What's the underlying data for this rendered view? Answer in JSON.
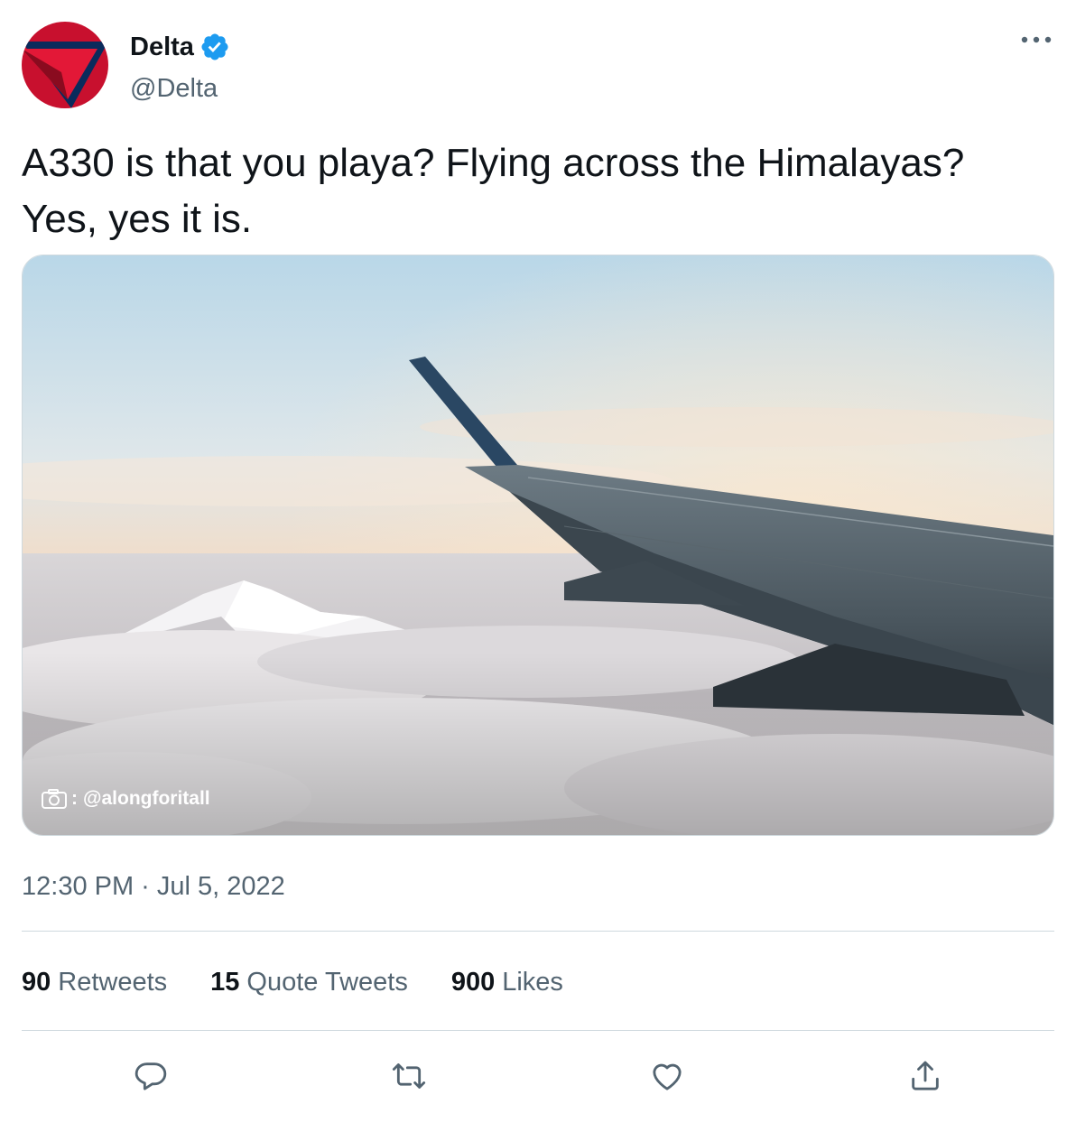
{
  "author": {
    "display_name": "Delta",
    "handle": "@Delta",
    "verified": true,
    "brand_colors": {
      "red": "#c8102e",
      "navy": "#0a2b5c"
    }
  },
  "tweet": {
    "text_lines": [
      "A330 is that you playa? Flying across the Himalayas?",
      "Yes, yes it is."
    ],
    "media": {
      "credit_separator": ":",
      "credit_handle": "@alongforitall",
      "credit_icon": "camera-icon"
    },
    "timestamp": "12:30 PM · Jul 5, 2022"
  },
  "stats": [
    {
      "count": "90",
      "label": "Retweets"
    },
    {
      "count": "15",
      "label": "Quote Tweets"
    },
    {
      "count": "900",
      "label": "Likes"
    }
  ],
  "actions": [
    {
      "icon": "reply-icon"
    },
    {
      "icon": "retweet-icon"
    },
    {
      "icon": "like-icon"
    },
    {
      "icon": "share-icon"
    }
  ],
  "colors": {
    "text_primary": "#0f1419",
    "text_secondary": "#536471",
    "verified_blue": "#1d9bf0",
    "divider": "#cfd9de"
  }
}
